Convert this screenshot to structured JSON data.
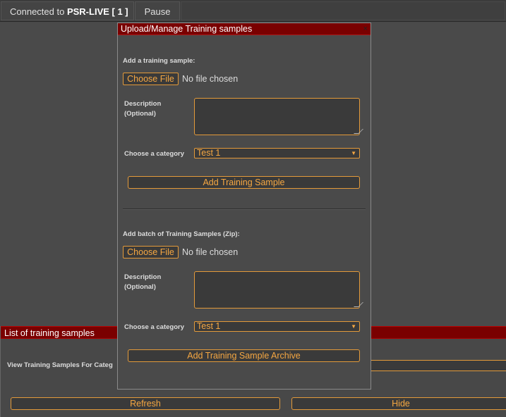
{
  "topbar": {
    "connected_prefix": "Connected to ",
    "connected_target": "PSR-LIVE [ 1 ]",
    "pause_label": "Pause"
  },
  "background_panel": {
    "title": "List of training samples",
    "view_label": "View Training Samples For Categ",
    "refresh_label": "Refresh",
    "hide_label": "Hide"
  },
  "dialog": {
    "title": "Upload/Manage Training samples",
    "close_glyph": "×",
    "single": {
      "heading": "Add a training sample:",
      "choose_file_label": "Choose File",
      "no_file_text": "No file chosen",
      "description_label_line1": "Description",
      "description_label_line2": "(Optional)",
      "description_value": "",
      "category_label": "Choose a category",
      "category_value": "Test 1",
      "submit_label": "Add Training Sample"
    },
    "batch": {
      "heading": "Add batch of Training Samples (Zip):",
      "choose_file_label": "Choose File",
      "no_file_text": "No file chosen",
      "description_label_line1": "Description",
      "description_label_line2": "(Optional)",
      "description_value": "",
      "category_label": "Choose a category",
      "category_value": "Test 1",
      "submit_label": "Add Training Sample Archive"
    }
  },
  "colors": {
    "accent": "#f5a742",
    "title_bar": "#7a0000",
    "background": "#4a4a4a"
  }
}
